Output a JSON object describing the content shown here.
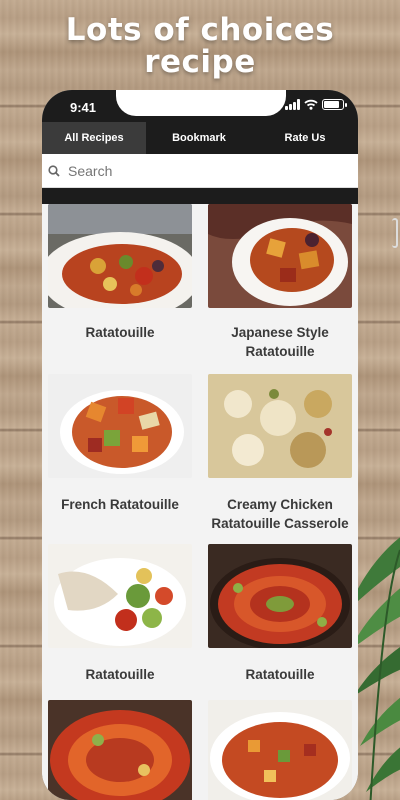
{
  "promo": {
    "headline_line1": "Lots of choices",
    "headline_line2": "recipe"
  },
  "status": {
    "time": "9:41"
  },
  "tabs": [
    {
      "label": "All Recipes",
      "active": true
    },
    {
      "label": "Bookmark",
      "active": false
    },
    {
      "label": "Rate Us",
      "active": false
    }
  ],
  "search": {
    "placeholder": "Search",
    "value": ""
  },
  "recipes": [
    {
      "title": "Ratatouille"
    },
    {
      "title": "Japanese Style Ratatouille"
    },
    {
      "title": "French Ratatouille"
    },
    {
      "title": "Creamy Chicken Ratatouille Casserole"
    },
    {
      "title": "Ratatouille"
    },
    {
      "title": "Ratatouille"
    },
    {
      "title": ""
    },
    {
      "title": ""
    }
  ],
  "colors": {
    "app_bar": "#1c1c1c",
    "active_tab": "#3b3b3b",
    "card_background": "#f3f3f3",
    "label_text": "#3a3a3a"
  },
  "icons": [
    "search-icon",
    "signal-icon",
    "wifi-icon",
    "battery-icon"
  ]
}
